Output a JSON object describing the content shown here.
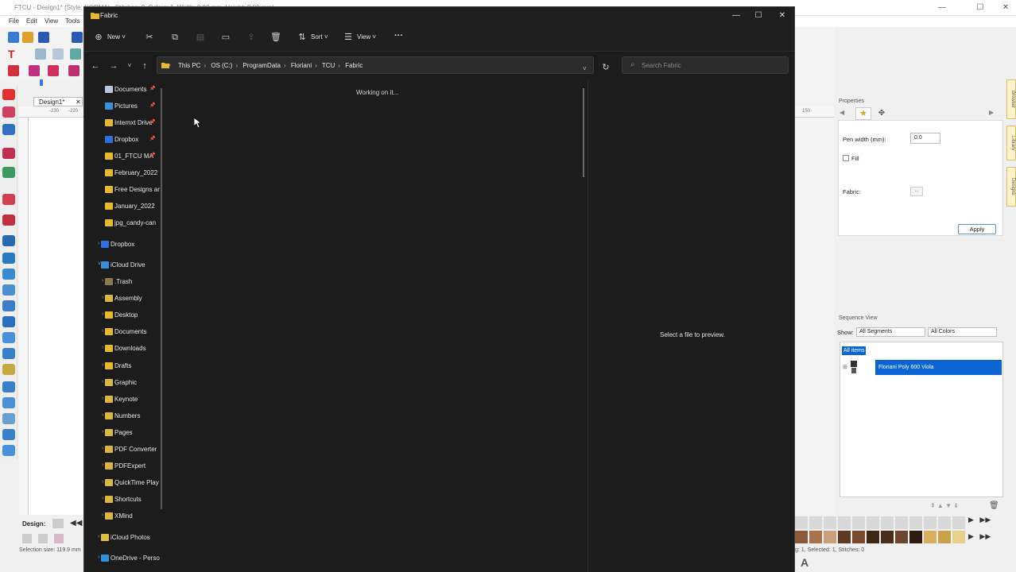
{
  "background_app": {
    "title": "FTCU - Design1* (Style: NORMAL, Stitches: 0, Colors: 1, Width: 0.00 mm, Height: 0.00 mm)",
    "menu": [
      "File",
      "Edit",
      "View",
      "Tools"
    ],
    "design_tab": "Design1*",
    "ruler_top_left": [
      "-230",
      "-220"
    ],
    "ruler_top_right": "150",
    "design_label": "Design:",
    "selection_size": "Selection size: 119.9 mm",
    "status_right": "g: 1, Selected: 1, Stitches: 0",
    "properties": {
      "header": "Properties",
      "pen_width_label": "Pen width (mm):",
      "pen_width_value": "0.0",
      "fill_label": "Fill",
      "fabric_label": "Fabric:",
      "fabric_button": "...",
      "apply_label": "Apply"
    },
    "side_tabs": [
      "Browser",
      "Library",
      "Designs"
    ],
    "sequence": {
      "header": "Sequence View",
      "show_label": "Show:",
      "segments_value": "All Segments",
      "colors_value": "All Colors",
      "all_items": "All items",
      "thread_name": "Floriani Poly 600 Viola"
    },
    "palette_colors": [
      "#8a5a3a",
      "#a8744e",
      "#c9a07a",
      "#5c3a24",
      "#7a4a2e",
      "#3d2614",
      "#4a2e1c",
      "#6b4630",
      "#2e1c10",
      "#d8b060",
      "#c9a24a",
      "#e6d08a"
    ],
    "canvas_glyph": "A"
  },
  "explorer": {
    "title": "Fabric",
    "window_controls": [
      "—",
      "☐",
      "✕"
    ],
    "commands": {
      "new_label": "New",
      "sort_label": "Sort",
      "view_label": "View",
      "more": "···"
    },
    "breadcrumbs": [
      "This PC",
      "OS (C:)",
      "ProgramData",
      "Floriani",
      "TCU",
      "Fabric"
    ],
    "search_placeholder": "Search Fabric",
    "status": "Working on it...",
    "preview_message": "Select a file to preview.",
    "quick_access": [
      {
        "label": "Documents",
        "pinned": true,
        "color": "#b8c8e0"
      },
      {
        "label": "Pictures",
        "pinned": true,
        "color": "#3a8fd8"
      },
      {
        "label": "Internxt Drive",
        "pinned": true,
        "color": "#e8b830"
      },
      {
        "label": "Dropbox",
        "pinned": true,
        "color": "#2f6fe0"
      },
      {
        "label": "01_FTCU MA",
        "pinned": true,
        "color": "#e8b830"
      },
      {
        "label": "February_2022",
        "pinned": false,
        "color": "#e8b830"
      },
      {
        "label": "Free Designs ar",
        "pinned": false,
        "color": "#e8b830"
      },
      {
        "label": "January_2022",
        "pinned": false,
        "color": "#e8b830"
      },
      {
        "label": "jpg_candy-can",
        "pinned": false,
        "color": "#e8b830"
      }
    ],
    "dropbox_root": "Dropbox",
    "icloud_root": "iCloud Drive",
    "icloud_children": [
      {
        "label": ".Trash",
        "color": "#8a7a50"
      },
      {
        "label": "Assembly",
        "color": "#d8b840"
      },
      {
        "label": "Desktop",
        "color": "#e8b830"
      },
      {
        "label": "Documents",
        "color": "#e8b830"
      },
      {
        "label": "Downloads",
        "color": "#e8b830"
      },
      {
        "label": "Drafts",
        "color": "#e8b830"
      },
      {
        "label": "Graphic",
        "color": "#d8b840"
      },
      {
        "label": "Keynote",
        "color": "#d8b840"
      },
      {
        "label": "Numbers",
        "color": "#d8b840"
      },
      {
        "label": "Pages",
        "color": "#d8b840"
      },
      {
        "label": "PDF Converter",
        "color": "#d8b840"
      },
      {
        "label": "PDFExpert",
        "color": "#d8b840"
      },
      {
        "label": "QuickTime Play",
        "color": "#d8b840"
      },
      {
        "label": "Shortcuts",
        "color": "#d8b840"
      },
      {
        "label": "XMind",
        "color": "#d8b840"
      }
    ],
    "icloud_photos": "iCloud Photos",
    "onedrive": "OneDrive - Perso"
  }
}
